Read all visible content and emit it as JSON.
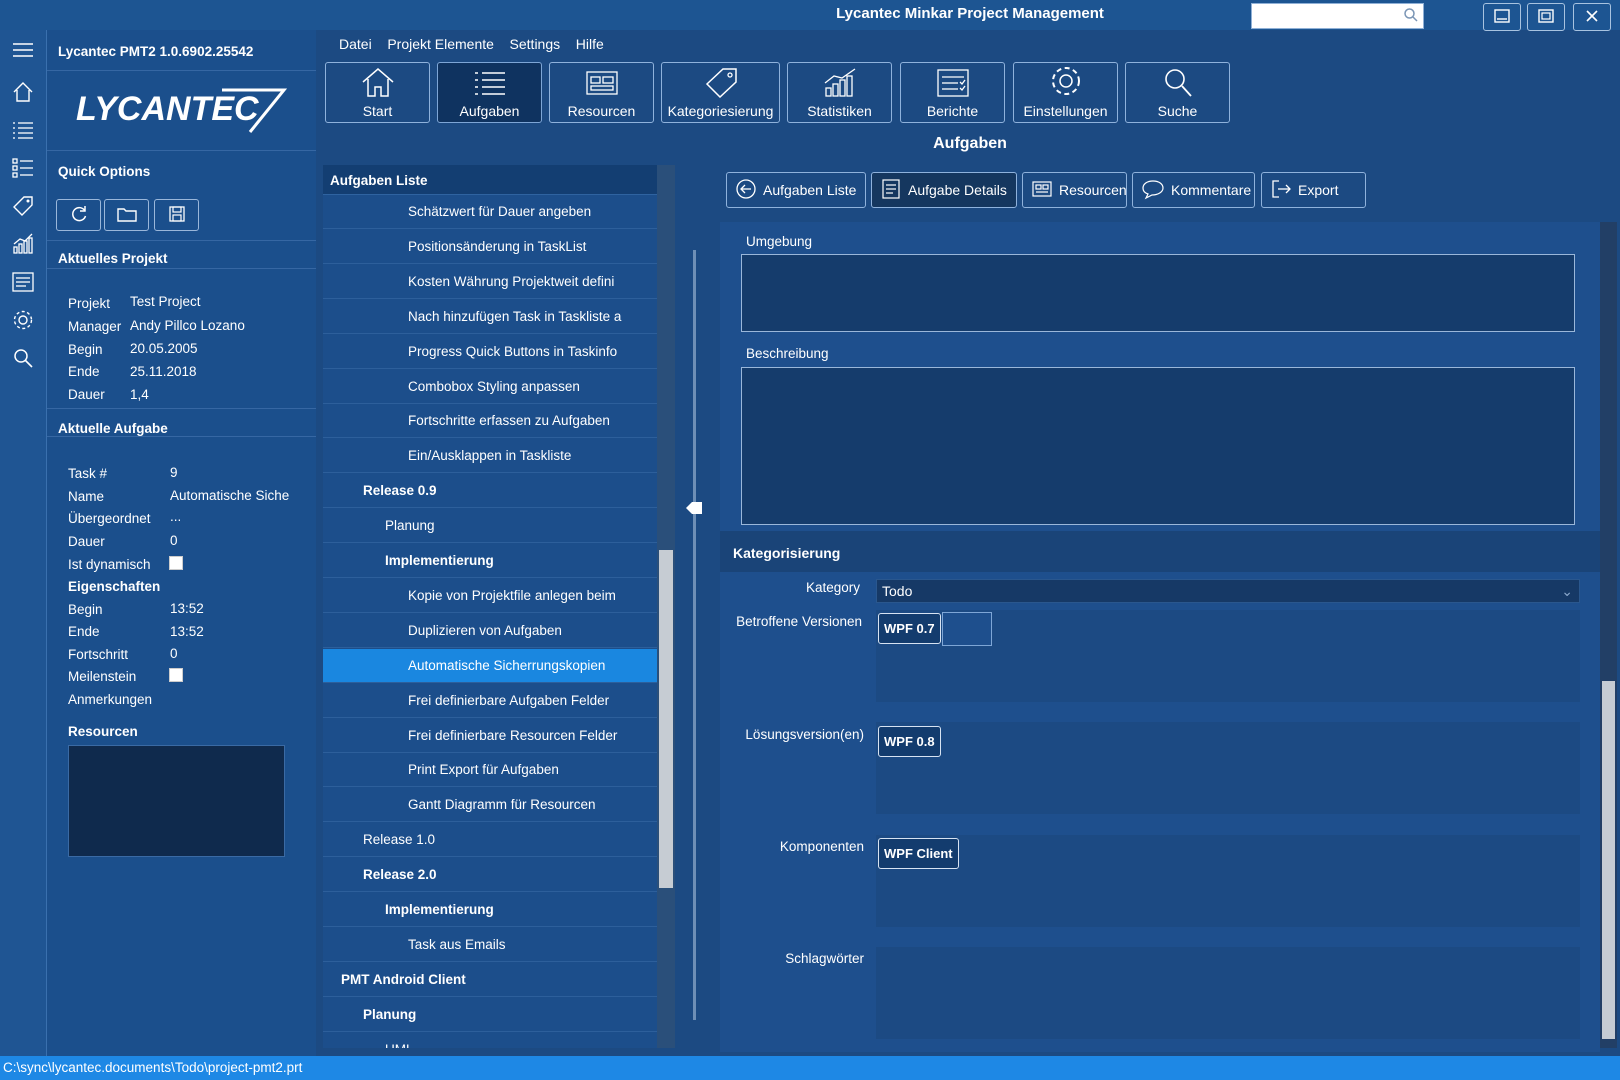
{
  "window": {
    "title": "Lycantec Minkar Project Management",
    "search_placeholder": ""
  },
  "sidebar_icons": [
    "hamburger-menu-icon",
    "home-icon",
    "list-icon",
    "task-list-icon",
    "tag-icon",
    "chart-icon",
    "report-icon",
    "gear-icon",
    "search-icon"
  ],
  "left_panel": {
    "version": "Lycantec PMT2 1.0.6902.25542",
    "logo_text": "LYCANTEC",
    "quick_options_title": "Quick Options",
    "project_title": "Aktuelles Projekt",
    "project": [
      {
        "label": "Projekt",
        "value": "Test Project"
      },
      {
        "label": "Manager",
        "value": "Andy Pillco Lozano"
      },
      {
        "label": "Begin",
        "value": "20.05.2005"
      },
      {
        "label": "Ende",
        "value": "25.11.2018"
      },
      {
        "label": "Dauer",
        "value": "1,4"
      }
    ],
    "task_title": "Aktuelle Aufgabe",
    "task": {
      "task_no_label": "Task #",
      "task_no": "9",
      "name_label": "Name",
      "name": "Automatische Siche",
      "parent_label": "Übergeordnet",
      "parent": "...",
      "duration_label": "Dauer",
      "duration": "0",
      "dynamic_label": "Ist dynamisch",
      "props_title": "Eigenschaften",
      "begin_label": "Begin",
      "begin": "13:52",
      "end_label": "Ende",
      "end": "13:52",
      "progress_label": "Fortschritt",
      "progress": "0",
      "milestone_label": "Meilenstein",
      "notes_label": "Anmerkungen"
    },
    "resources_title": "Resourcen"
  },
  "menu": [
    "Datei",
    "Projekt Elemente",
    "Settings",
    "Hilfe"
  ],
  "ribbon": [
    {
      "label": "Start",
      "icon": "home-icon"
    },
    {
      "label": "Aufgaben",
      "icon": "list-icon"
    },
    {
      "label": "Resourcen",
      "icon": "resources-icon"
    },
    {
      "label": "Kategoriesierung",
      "icon": "tag-icon"
    },
    {
      "label": "Statistiken",
      "icon": "chart-icon"
    },
    {
      "label": "Berichte",
      "icon": "report-icon"
    },
    {
      "label": "Einstellungen",
      "icon": "gear-icon"
    },
    {
      "label": "Suche",
      "icon": "search-icon"
    }
  ],
  "page_title": "Aufgaben",
  "tasklist": {
    "header": "Aufgaben Liste",
    "rows": [
      {
        "text": "Schätzwert für Dauer angeben",
        "level": 3
      },
      {
        "text": "Positionsänderung in TaskList",
        "level": 3
      },
      {
        "text": "Kosten Währung Projektweit defini",
        "level": 3
      },
      {
        "text": "Nach hinzufügen Task in Taskliste a",
        "level": 3
      },
      {
        "text": "Progress Quick Buttons in Taskinfo",
        "level": 3
      },
      {
        "text": "Combobox Styling anpassen",
        "level": 3
      },
      {
        "text": "Fortschritte erfassen zu Aufgaben",
        "level": 3
      },
      {
        "text": "Ein/Ausklappen in Taskliste",
        "level": 3
      },
      {
        "text": "Release 0.9",
        "level": 1,
        "bold": true
      },
      {
        "text": "Planung",
        "level": 2
      },
      {
        "text": "Implementierung",
        "level": 2,
        "bold": true
      },
      {
        "text": "Kopie von Projektfile anlegen beim",
        "level": 3
      },
      {
        "text": "Duplizieren von Aufgaben",
        "level": 3
      },
      {
        "text": "Automatische Sicherrungskopien",
        "level": 3,
        "selected": true
      },
      {
        "text": "Frei definierbare Aufgaben Felder",
        "level": 3
      },
      {
        "text": "Frei definierbare Resourcen Felder",
        "level": 3
      },
      {
        "text": "Print Export für Aufgaben",
        "level": 3
      },
      {
        "text": "Gantt Diagramm für Resourcen",
        "level": 3
      },
      {
        "text": "Release 1.0",
        "level": 1
      },
      {
        "text": "Release 2.0",
        "level": 1,
        "bold": true
      },
      {
        "text": "Implementierung",
        "level": 2,
        "bold": true
      },
      {
        "text": "Task aus Emails",
        "level": 3
      },
      {
        "text": "PMT Android Client",
        "level": 0,
        "bold": true
      },
      {
        "text": "Planung",
        "level": 1,
        "bold": true
      },
      {
        "text": "UML",
        "level": 2
      }
    ]
  },
  "detail_tabs": [
    {
      "label": "Aufgaben Liste",
      "icon": "back-arrow-icon"
    },
    {
      "label": "Aufgabe Details",
      "icon": "details-icon"
    },
    {
      "label": "Resourcen",
      "icon": "resources-icon"
    },
    {
      "label": "Kommentare",
      "icon": "comment-icon"
    },
    {
      "label": "Export",
      "icon": "export-icon"
    }
  ],
  "details": {
    "umgebung_label": "Umgebung",
    "beschreibung_label": "Beschreibung",
    "kat_title": "Kategorisierung",
    "kategory_label": "Kategory",
    "kategory_value": "Todo",
    "versions_label": "Betroffene Versionen",
    "versions": [
      "WPF 0.7"
    ],
    "solution_label": "Lösungsversion(en)",
    "solutions": [
      "WPF 0.8"
    ],
    "components_label": "Komponenten",
    "components": [
      "WPF Client"
    ],
    "keywords_label": "Schlagwörter"
  },
  "status_path": "C:\\sync\\lycantec.documents\\Todo\\project-pmt2.prt",
  "colors": {
    "accent": "#1a87e0",
    "background": "#1c4a82",
    "status": "#1e88e5"
  }
}
